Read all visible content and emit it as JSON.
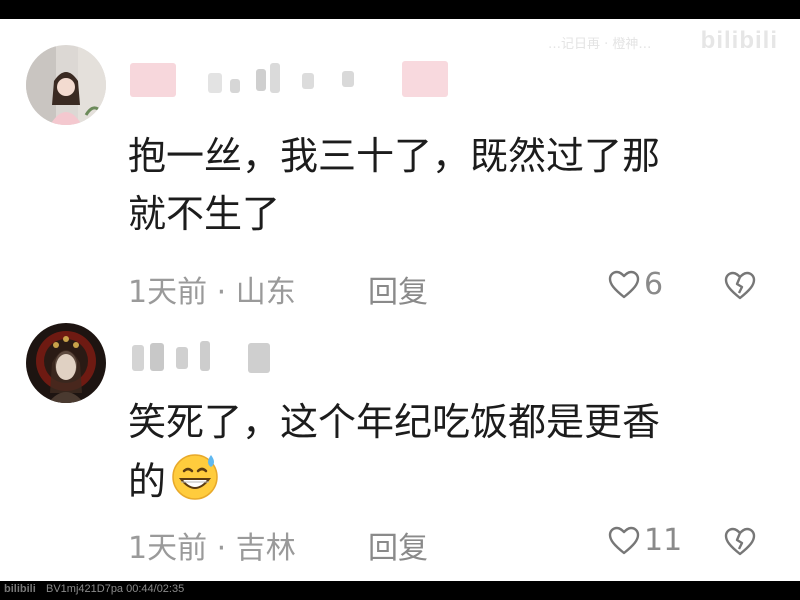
{
  "watermark": {
    "logo": "bilibili",
    "overlay_text": "…记日再 · 橙神…"
  },
  "comments": [
    {
      "text": "抱一丝，我三十了，既然过了那\n就不生了",
      "time_location": "1天前 · 山东",
      "reply_label": "回复",
      "like_count": "6"
    },
    {
      "text": "笑死了，这个年纪吃饭都是更香\n的",
      "emoji": "grinning-sweat-emoji",
      "time_location": "1天前 · 吉林",
      "reply_label": "回复",
      "like_count": "11"
    }
  ],
  "bottom_bar": {
    "logo": "bilibili",
    "video_info": "BV1mj421D7pa 00:44/02:35"
  },
  "colors": {
    "text": "#1c1c1c",
    "meta": "#9a9a9a",
    "background": "#ffffff"
  }
}
